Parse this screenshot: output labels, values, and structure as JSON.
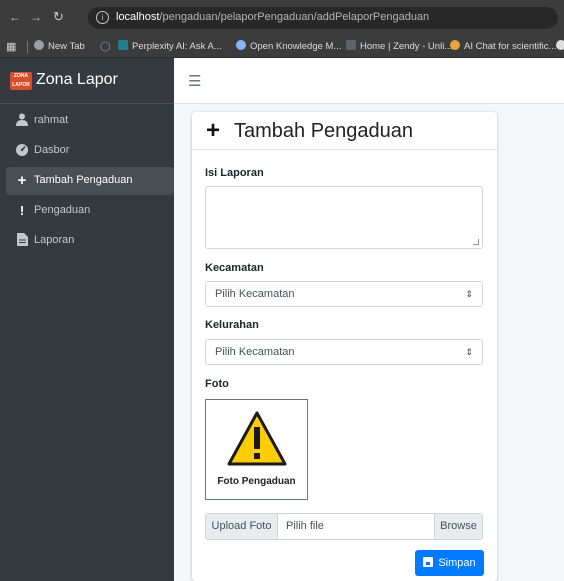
{
  "browser": {
    "url_host": "localhost",
    "url_path": "/pengaduan/pelaporPengaduan/addPelaporPengaduan",
    "bookmarks": [
      "New Tab",
      "Perplexity AI: Ask A...",
      "Open Knowledge M...",
      "Home | Zendy - Unli...",
      "AI Chat for scientific..."
    ]
  },
  "brand": {
    "logo_line1": "ZONA",
    "logo_line2": "LAPOR",
    "name": "Zona Lapor"
  },
  "sidebar": {
    "items": [
      {
        "label": "rahmat",
        "icon": "user-icon",
        "active": false
      },
      {
        "label": "Dasbor",
        "icon": "dashboard-icon",
        "active": false
      },
      {
        "label": "Tambah Pengaduan",
        "icon": "plus-icon",
        "active": true
      },
      {
        "label": "Pengaduan",
        "icon": "exclamation-icon",
        "active": false
      },
      {
        "label": "Laporan",
        "icon": "file-icon",
        "active": false
      }
    ]
  },
  "form": {
    "title": "Tambah Pengaduan",
    "isi_label": "Isi Laporan",
    "isi_value": "",
    "kecamatan_label": "Kecamatan",
    "kecamatan_value": "Pilih Kecamatan",
    "kelurahan_label": "Kelurahan",
    "kelurahan_value": "Pilih Kecamatan",
    "foto_label": "Foto",
    "foto_caption": "Foto Pengaduan",
    "upload_prefix": "Upload Foto",
    "upload_placeholder": "Pilih file",
    "browse_label": "Browse",
    "save_label": "Simpan"
  },
  "colors": {
    "sidebar_bg": "#343a40",
    "active_item_bg": "#494e53",
    "primary": "#007bff",
    "warning_yellow": "#ffcc00"
  }
}
